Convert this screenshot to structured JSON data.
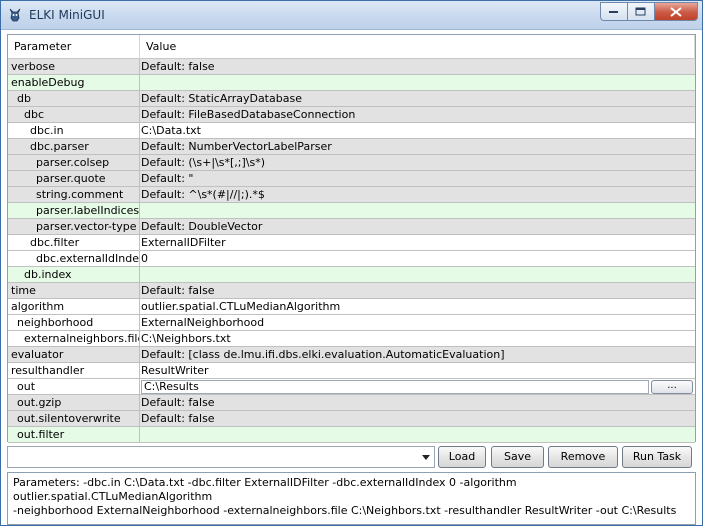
{
  "window": {
    "title": "ELKI MiniGUI"
  },
  "table": {
    "headers": [
      "Parameter",
      "Value"
    ],
    "rows": [
      {
        "param": "verbose",
        "value": "Default: false",
        "indent": 0,
        "style": "grey"
      },
      {
        "param": "enableDebug",
        "value": "",
        "indent": 0,
        "style": "green"
      },
      {
        "param": "db",
        "value": "Default: StaticArrayDatabase",
        "indent": 1,
        "style": "grey"
      },
      {
        "param": "dbc",
        "value": "Default: FileBasedDatabaseConnection",
        "indent": 2,
        "style": "grey"
      },
      {
        "param": "dbc.in",
        "value": "C:\\Data.txt",
        "indent": 3,
        "style": "white"
      },
      {
        "param": "dbc.parser",
        "value": "Default: NumberVectorLabelParser",
        "indent": 3,
        "style": "grey"
      },
      {
        "param": "parser.colsep",
        "value": "Default: (\\s+|\\s*[,;]\\s*)",
        "indent": 4,
        "style": "grey"
      },
      {
        "param": "parser.quote",
        "value": "Default: \"",
        "indent": 4,
        "style": "grey"
      },
      {
        "param": "string.comment",
        "value": "Default: ^\\s*(#|//|;).*$",
        "indent": 4,
        "style": "grey"
      },
      {
        "param": "parser.labelIndices",
        "value": "",
        "indent": 4,
        "style": "green"
      },
      {
        "param": "parser.vector-type",
        "value": "Default: DoubleVector",
        "indent": 4,
        "style": "grey"
      },
      {
        "param": "dbc.filter",
        "value": "ExternalIDFilter",
        "indent": 3,
        "style": "white"
      },
      {
        "param": "dbc.externalIdIndex",
        "value": "0",
        "indent": 4,
        "style": "white"
      },
      {
        "param": "db.index",
        "value": "",
        "indent": 2,
        "style": "green"
      },
      {
        "param": "time",
        "value": "Default: false",
        "indent": 0,
        "style": "grey"
      },
      {
        "param": "algorithm",
        "value": "outlier.spatial.CTLuMedianAlgorithm",
        "indent": 0,
        "style": "white"
      },
      {
        "param": "neighborhood",
        "value": "ExternalNeighborhood",
        "indent": 1,
        "style": "white"
      },
      {
        "param": "externalneighbors.file",
        "value": "C:\\Neighbors.txt",
        "indent": 2,
        "style": "white"
      },
      {
        "param": "evaluator",
        "value": "Default: [class de.lmu.ifi.dbs.elki.evaluation.AutomaticEvaluation]",
        "indent": 0,
        "style": "grey"
      },
      {
        "param": "resulthandler",
        "value": "ResultWriter",
        "indent": 0,
        "style": "white"
      },
      {
        "param": "out",
        "value": "C:\\Results",
        "indent": 1,
        "style": "white",
        "file": true,
        "button": "..."
      },
      {
        "param": "out.gzip",
        "value": "Default: false",
        "indent": 1,
        "style": "grey"
      },
      {
        "param": "out.silentoverwrite",
        "value": "Default: false",
        "indent": 1,
        "style": "grey"
      },
      {
        "param": "out.filter",
        "value": "",
        "indent": 1,
        "style": "green"
      }
    ]
  },
  "toolbar": {
    "combo_value": "",
    "load_label": "Load",
    "save_label": "Save",
    "remove_label": "Remove",
    "run_label": "Run Task"
  },
  "output": {
    "text": "Parameters: -dbc.in C:\\Data.txt -dbc.filter ExternalIDFilter -dbc.externalIdIndex 0 -algorithm outlier.spatial.CTLuMedianAlgorithm\n-neighborhood ExternalNeighborhood -externalneighbors.file C:\\Neighbors.txt -resulthandler ResultWriter -out C:\\Results"
  },
  "colors": {
    "row_grey": "#e2e2e2",
    "row_white": "#ffffff",
    "row_green": "#e6fbe6",
    "title_text": "#1e395b",
    "close_button": "#c24128"
  },
  "icons": [
    "elki-logo-icon",
    "minimize-icon",
    "maximize-icon",
    "close-icon",
    "dropdown-arrow-icon"
  ]
}
